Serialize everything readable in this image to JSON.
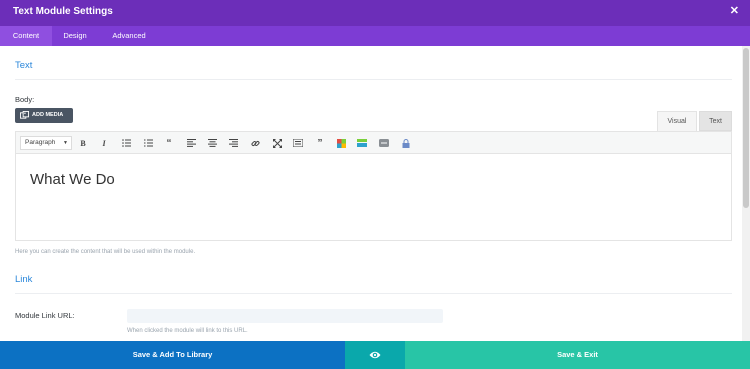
{
  "modal": {
    "title": "Text Module Settings",
    "close_symbol": "✕"
  },
  "tabs": [
    {
      "label": "Content",
      "active": true
    },
    {
      "label": "Design",
      "active": false
    },
    {
      "label": "Advanced",
      "active": false
    }
  ],
  "sections": {
    "text": {
      "title": "Text"
    },
    "link": {
      "title": "Link"
    }
  },
  "body_field": {
    "label": "Body:",
    "add_media_label": "ADD MEDIA",
    "editor_tabs": {
      "visual": "Visual",
      "text": "Text"
    },
    "format_select": "Paragraph",
    "toolbar_icons": [
      "bold-icon",
      "italic-icon",
      "bullet-list-icon",
      "numbered-list-icon",
      "blockquote-icon",
      "align-left-icon",
      "align-center-icon",
      "align-right-icon",
      "link-icon",
      "fullscreen-icon",
      "toolbar-toggle-icon",
      "quote-icon",
      "color-icon",
      "highlight-icon",
      "underline-icon",
      "lock-icon"
    ],
    "content": "What We Do",
    "help": "Here you can create the content that will be used within the module."
  },
  "link_field": {
    "label": "Module Link URL:",
    "value": "",
    "help": "When clicked the module will link to this URL."
  },
  "footer": {
    "library_label": "Save & Add To Library",
    "preview_icon": "eye-icon",
    "save_exit_label": "Save & Exit"
  },
  "colors": {
    "header": "#6c2eb9",
    "tabs": "#7d3cd4",
    "section_title": "#2b87da",
    "library_button": "#0c71c3",
    "preview_button": "#0aa8ab",
    "save_exit_button": "#28c5a6"
  }
}
